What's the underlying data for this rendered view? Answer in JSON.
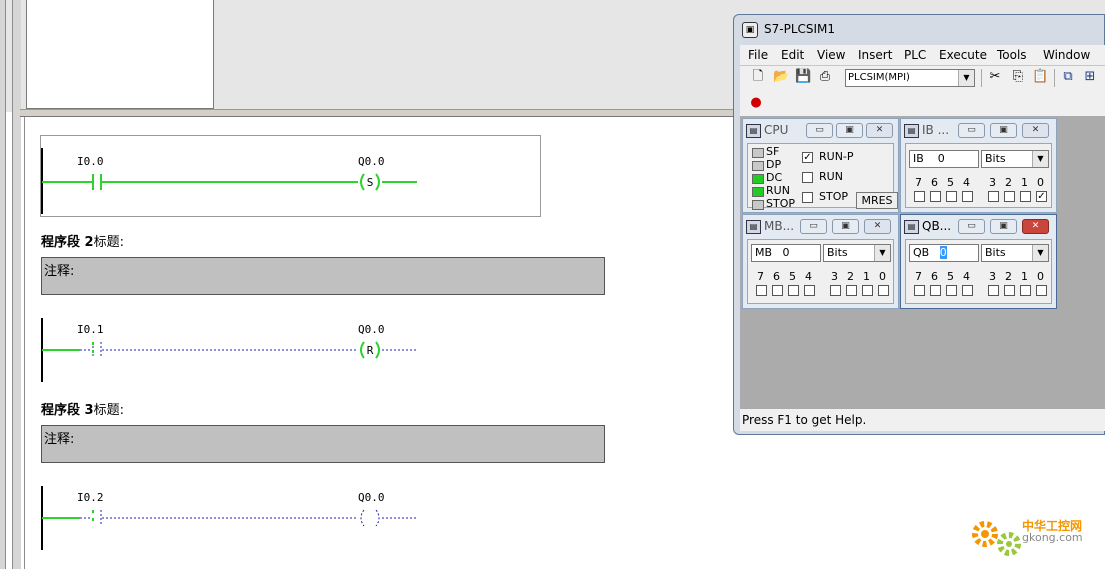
{
  "ladder": {
    "network1": {
      "contact": "I0.0",
      "coil": "Q0.0",
      "coil_symbol": "S"
    },
    "network2": {
      "header_label": "程序段",
      "number": "2",
      "title": "标题:",
      "comment": "注释:",
      "contact": "I0.1",
      "coil": "Q0.0",
      "coil_symbol": "R"
    },
    "network3": {
      "header_label": "程序段",
      "number": "3",
      "title": "标题:",
      "comment": "注释:",
      "contact": "I0.2",
      "coil": "Q0.0"
    }
  },
  "plcsim": {
    "title": "S7-PLCSIM1",
    "menu": [
      "File",
      "Edit",
      "View",
      "Insert",
      "PLC",
      "Execute",
      "Tools",
      "Window"
    ],
    "connection": "PLCSIM(MPI)",
    "status_text": "Press F1 to get Help.",
    "cpu": {
      "title": "CPU",
      "leds": [
        {
          "label": "SF",
          "color": "#c8c8c8"
        },
        {
          "label": "DP",
          "color": "#c8c8c8"
        },
        {
          "label": "DC",
          "color": "#22cc22"
        },
        {
          "label": "RUN",
          "color": "#22cc22"
        },
        {
          "label": "STOP",
          "color": "#c8c8c8"
        }
      ],
      "modes": [
        {
          "label": "RUN-P",
          "checked": true
        },
        {
          "label": "RUN",
          "checked": false
        },
        {
          "label": "STOP",
          "checked": false
        }
      ],
      "mres_label": "MRES"
    },
    "ib": {
      "title": "IB ...",
      "area": "IB",
      "address": "0",
      "format": "Bits",
      "bit_labels": [
        "7",
        "6",
        "5",
        "4",
        "3",
        "2",
        "1",
        "0"
      ],
      "bits": [
        false,
        false,
        false,
        false,
        false,
        false,
        false,
        true
      ]
    },
    "mb": {
      "title": "MB...",
      "area": "MB",
      "address": "0",
      "format": "Bits",
      "bit_labels": [
        "7",
        "6",
        "5",
        "4",
        "3",
        "2",
        "1",
        "0"
      ],
      "bits": [
        false,
        false,
        false,
        false,
        false,
        false,
        false,
        false
      ]
    },
    "qb": {
      "title": "QB...",
      "area": "QB",
      "address": "0",
      "format": "Bits",
      "bit_labels": [
        "7",
        "6",
        "5",
        "4",
        "3",
        "2",
        "1",
        "0"
      ],
      "bits": [
        false,
        false,
        false,
        false,
        false,
        false,
        false,
        false
      ]
    }
  },
  "watermark": {
    "line1": "中华工控网",
    "line2": "gkong.com"
  },
  "colors": {
    "energized": "#2bd42b",
    "deenergized": "#1c1cb4",
    "comment_bg": "#c0c0c0"
  }
}
